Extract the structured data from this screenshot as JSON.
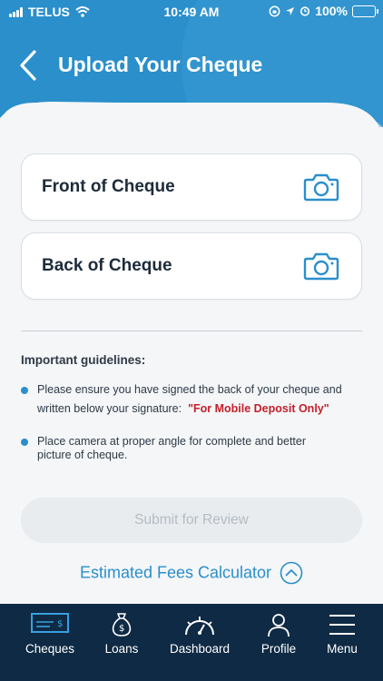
{
  "status_bar": {
    "carrier": "TELUS",
    "time": "10:49 AM",
    "battery": "100%"
  },
  "header": {
    "title": "Upload Your Cheque"
  },
  "upload": {
    "front_label": "Front of Cheque",
    "back_label": "Back of Cheque"
  },
  "guidelines": {
    "title": "Important guidelines:",
    "item1_line1": "Please ensure you have signed the back of your cheque and",
    "item1_line2": "written below your signature:",
    "item1_highlight": "\"For Mobile Deposit Only\"",
    "item2_line1": "Place camera at proper angle for complete and better",
    "item2_line2": "picture of cheque."
  },
  "actions": {
    "submit_label": "Submit for Review",
    "fees_label": "Estimated Fees Calculator"
  },
  "tabs": [
    {
      "label": "Cheques",
      "icon": "cheque-icon"
    },
    {
      "label": "Loans",
      "icon": "money-bag-icon"
    },
    {
      "label": "Dashboard",
      "icon": "gauge-icon"
    },
    {
      "label": "Profile",
      "icon": "person-icon"
    },
    {
      "label": "Menu",
      "icon": "hamburger-icon"
    }
  ],
  "colors": {
    "header_blue": "#2a8fcb",
    "accent_blue": "#2a8fcb",
    "tabbar_bg": "#0f2a44",
    "highlight_red": "#c3202a",
    "battery_green": "#4cd964"
  }
}
